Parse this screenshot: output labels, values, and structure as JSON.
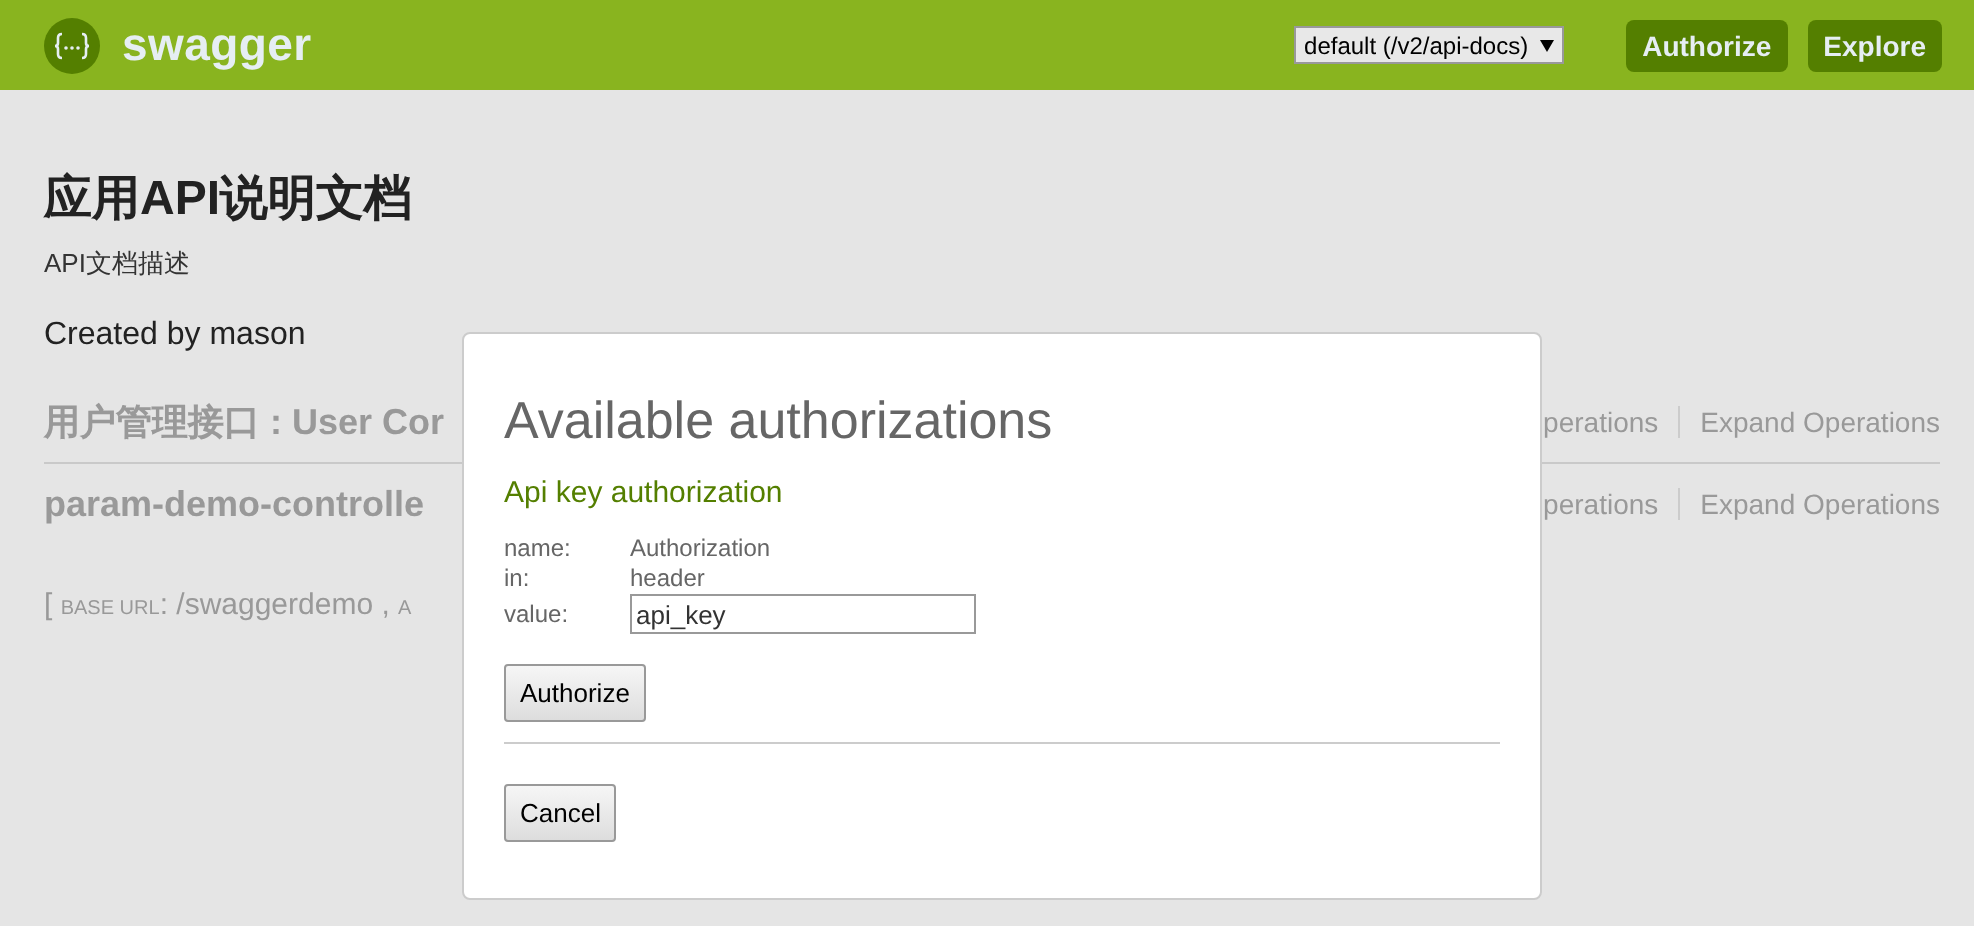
{
  "header": {
    "brand": "swagger",
    "spec_select": "default (/v2/api-docs)",
    "buttons": [
      "Authorize",
      "Explore"
    ]
  },
  "info": {
    "title": "应用API说明文档",
    "description": "API文档描述",
    "contact": "Created by mason"
  },
  "resources": [
    {
      "name": "用户管理接口 : User Cor",
      "links": [
        "perations",
        "Expand Operations"
      ]
    },
    {
      "name": "param-demo-controlle",
      "links": [
        "perations",
        "Expand Operations"
      ]
    }
  ],
  "base_url": [
    {
      "kind": "plain",
      "text": "[ "
    },
    {
      "kind": "caps",
      "text": "BASE URL"
    },
    {
      "kind": "plain",
      "text": ": /swaggerdemo , "
    },
    {
      "kind": "caps",
      "text": "A"
    }
  ],
  "dialog": {
    "title": "Available authorizations",
    "section": "Api key authorization",
    "fields": [
      {
        "label": "name:",
        "value": "Authorization",
        "kind": "text"
      },
      {
        "label": "in:",
        "value": "header",
        "kind": "text"
      },
      {
        "label": "value:",
        "value": "api_key",
        "kind": "input"
      }
    ],
    "buttons": [
      "Authorize",
      "Cancel"
    ]
  }
}
